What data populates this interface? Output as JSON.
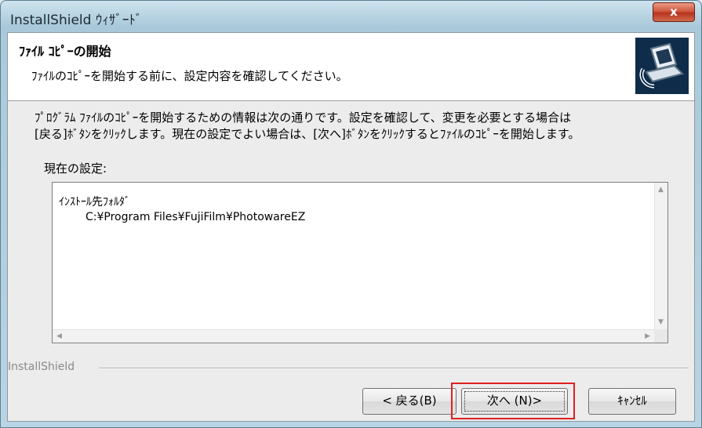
{
  "window": {
    "title": "InstallShield ｳｨｻﾞｰﾄﾞ",
    "close_label": "x"
  },
  "header": {
    "title": "ﾌｧｲﾙ ｺﾋﾟｰの開始",
    "subtitle": "ﾌｧｲﾙのｺﾋﾟｰを開始する前に、設定内容を確認してください。",
    "logo_icon": "installer-computer-icon"
  },
  "body": {
    "description_line1": "ﾌﾟﾛｸﾞﾗﾑ ﾌｧｲﾙのｺﾋﾟｰを開始するための情報は次の通りです。設定を確認して、変更を必要とする場合は",
    "description_line2": "[戻る]ﾎﾞﾀﾝをｸﾘｯｸします。現在の設定でよい場合は、[次へ]ﾎﾞﾀﾝをｸﾘｯｸするとﾌｧｲﾙのｺﾋﾟｰを開始します。",
    "current_settings_label": "現在の設定:",
    "settings_box": {
      "line1": "ｲﾝｽﾄｰﾙ先ﾌｫﾙﾀﾞ",
      "line2": "C:¥Program Files¥FujiFilm¥PhotowareEZ"
    }
  },
  "footer": {
    "brand_label": "InstallShield"
  },
  "buttons": {
    "back": "< 戻る(B)",
    "next": "次へ (N)>",
    "cancel": "ｷｬﾝｾﾙ"
  },
  "colors": {
    "highlight": "#e02020",
    "close_button": "#c9452b"
  }
}
